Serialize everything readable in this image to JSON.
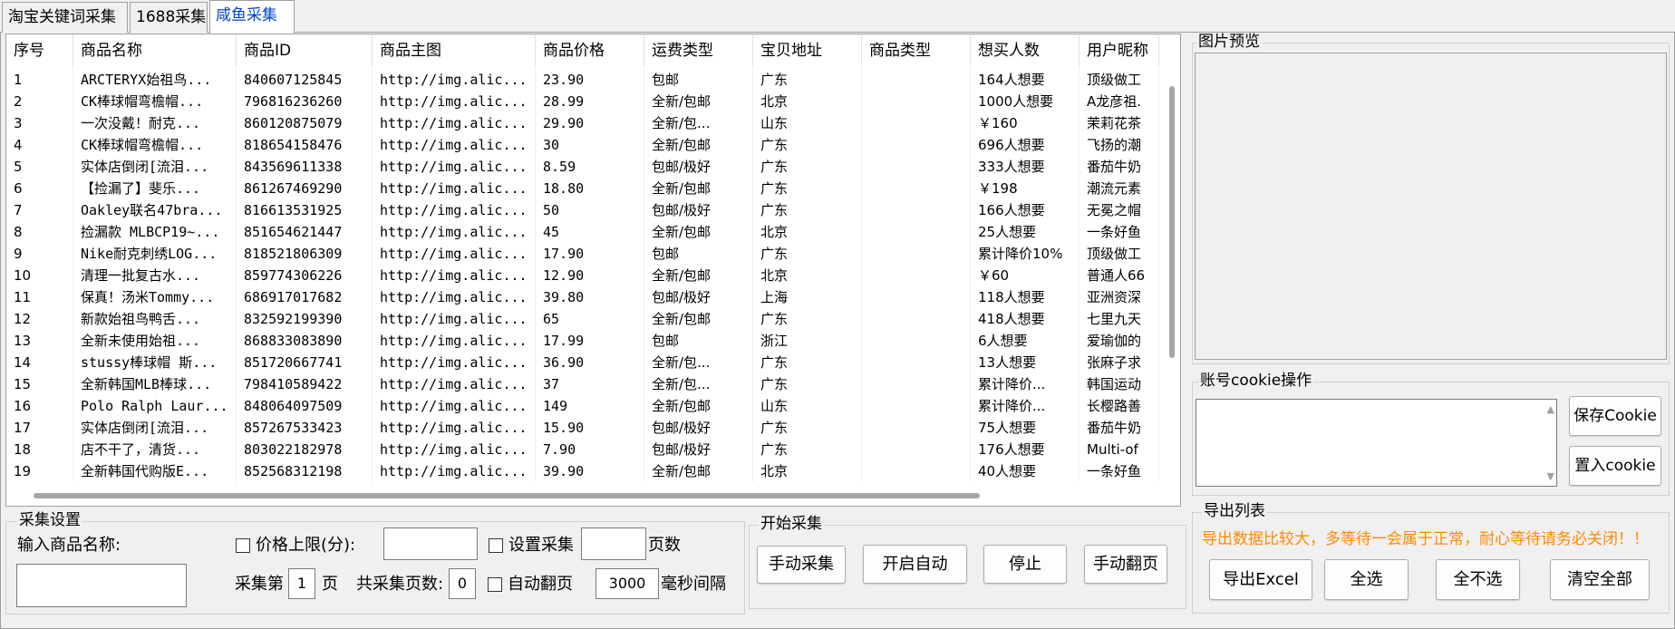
{
  "tabs": [
    "淘宝关键词采集",
    "1688采集",
    "咸鱼采集"
  ],
  "table": {
    "columns": [
      "序号",
      "商品名称",
      "商品ID",
      "商品主图",
      "商品价格",
      "运费类型",
      "宝贝地址",
      "商品类型",
      "想买人数",
      "用户昵称"
    ],
    "rows": [
      [
        "1",
        "ARCTERYX始祖鸟...",
        "840607125845",
        "http://img.alic...",
        "23.90",
        "包邮",
        "广东",
        "",
        "164人想要",
        "顶级做工"
      ],
      [
        "2",
        "CK棒球帽弯檐帽...",
        "796816236260",
        "http://img.alic...",
        "28.99",
        "全新/包邮",
        "北京",
        "",
        "1000人想要",
        "A龙彦祖."
      ],
      [
        "3",
        "一次没戴！耐克...",
        "860120875079",
        "http://img.alic...",
        "29.90",
        "全新/包...",
        "山东",
        "",
        "￥160",
        "茉莉花茶"
      ],
      [
        "4",
        "CK棒球帽弯檐帽...",
        "818654158476",
        "http://img.alic...",
        "30",
        "全新/包邮",
        "广东",
        "",
        "696人想要",
        "飞扬的潮"
      ],
      [
        "5",
        "实体店倒闭[流泪...",
        "843569611338",
        "http://img.alic...",
        "8.59",
        "包邮/极好",
        "广东",
        "",
        "333人想要",
        "番茄牛奶"
      ],
      [
        "6",
        "【捡漏了】斐乐...",
        "861267469290",
        "http://img.alic...",
        "18.80",
        "全新/包邮",
        "广东",
        "",
        "￥198",
        "潮流元素"
      ],
      [
        "7",
        "Oakley联名47bra...",
        "816613531925",
        "http://img.alic...",
        "50",
        "包邮/极好",
        "广东",
        "",
        "166人想要",
        "无冕之帽"
      ],
      [
        "8",
        "捡漏款 MLBCP19~...",
        "851654621447",
        "http://img.alic...",
        "45",
        "全新/包邮",
        "北京",
        "",
        "25人想要",
        "一条好鱼"
      ],
      [
        "9",
        "Nike耐克刺绣LOG...",
        "818521806309",
        "http://img.alic...",
        "17.90",
        "包邮",
        "广东",
        "",
        "累计降价10%",
        "顶级做工"
      ],
      [
        "10",
        "清理一批复古水...",
        "859774306226",
        "http://img.alic...",
        "12.90",
        "全新/包邮",
        "北京",
        "",
        "￥60",
        "普通人66"
      ],
      [
        "11",
        "保真！汤米Tommy...",
        "686917017682",
        "http://img.alic...",
        "39.80",
        "包邮/极好",
        "上海",
        "",
        "118人想要",
        "亚洲资深"
      ],
      [
        "12",
        "新款始祖鸟鸭舌...",
        "832592199390",
        "http://img.alic...",
        "65",
        "全新/包邮",
        "广东",
        "",
        "418人想要",
        "七里九天"
      ],
      [
        "13",
        "全新未使用始祖...",
        "868833083890",
        "http://img.alic...",
        "17.99",
        "包邮",
        "浙江",
        "",
        "6人想要",
        "爱瑜伽的"
      ],
      [
        "14",
        "stussy棒球帽 斯...",
        "851720667741",
        "http://img.alic...",
        "36.90",
        "全新/包...",
        "广东",
        "",
        "13人想要",
        "张麻子求"
      ],
      [
        "15",
        "全新韩国MLB棒球...",
        "798410589422",
        "http://img.alic...",
        "37",
        "全新/包...",
        "广东",
        "",
        "累计降价...",
        "韩国运动"
      ],
      [
        "16",
        "Polo Ralph Laur...",
        "848064097509",
        "http://img.alic...",
        "149",
        "全新/包邮",
        "山东",
        "",
        "累计降价...",
        "长樱路善"
      ],
      [
        "17",
        "实体店倒闭[流泪...",
        "857267533423",
        "http://img.alic...",
        "15.90",
        "包邮/极好",
        "广东",
        "",
        "75人想要",
        "番茄牛奶"
      ],
      [
        "18",
        "店不干了，清货...",
        "803022182978",
        "http://img.alic...",
        "7.90",
        "包邮/极好",
        "广东",
        "",
        "176人想要",
        "Multi-of"
      ],
      [
        "19",
        "全新韩国代购版E...",
        "852568312198",
        "http://img.alic...",
        "39.90",
        "全新/包邮",
        "北京",
        "",
        "40人想要",
        "一条好鱼"
      ]
    ]
  },
  "preview": {
    "title": "图片预览"
  },
  "cookie": {
    "title": "账号cookie操作",
    "save_label": "保存Cookie",
    "import_label": "置入cookie"
  },
  "settings": {
    "title": "采集设置",
    "name_label": "输入商品名称:",
    "name_value": "",
    "price_limit_label": "价格上限(分):",
    "price_limit_value": "",
    "set_collect_label": "设置采集",
    "pages_value": "",
    "pages_label": "页数",
    "collect_page_prefix": "采集第",
    "collect_page_value": "1",
    "collect_page_suffix": "页",
    "total_pages_label": "共采集页数:",
    "total_pages_value": "0",
    "auto_page_label": "自动翻页",
    "interval_value": "3000",
    "interval_label": "毫秒间隔"
  },
  "start": {
    "title": "开始采集",
    "manual_label": "手动采集",
    "auto_label": "开启自动",
    "stop_label": "停止",
    "next_page_label": "手动翻页"
  },
  "export": {
    "title": "导出列表",
    "warning": "导出数据比较大，多等待一会属于正常，耐心等待请务必关闭！！",
    "excel_label": "导出Excel",
    "select_all_label": "全选",
    "select_none_label": "全不选",
    "clear_label": "清空全部"
  },
  "colors": {
    "active_tab": "#0045c8",
    "warning": "#ff8a00"
  }
}
